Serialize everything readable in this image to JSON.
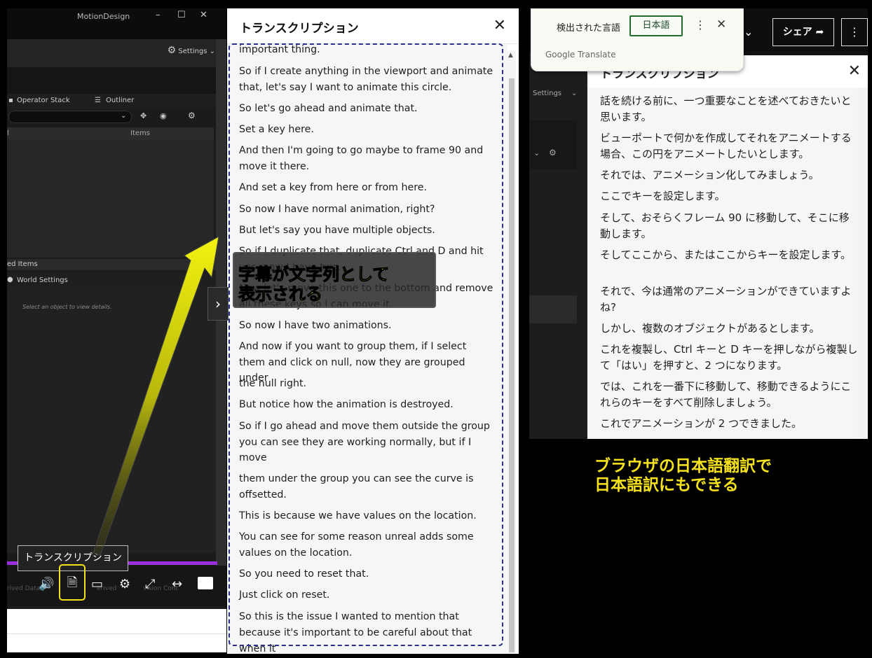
{
  "video": {
    "window_title": "MotionDesign",
    "window_controls": [
      "–",
      "☐",
      "✕"
    ],
    "settings_label": "Settings",
    "operator_stack": "Operator Stack",
    "outliner": "Outliner",
    "column_left": "l",
    "column_items": "Items",
    "section_items": "ed Items",
    "world_settings": "World Settings",
    "details_hint": "Select an object to view details.",
    "bottom_faint_left": "rived Data",
    "bottom_faint_mid": "erived",
    "bottom_faint_right": "vision Cont",
    "tooltip": "トランスクリプション"
  },
  "transcript": {
    "title": "トランスクリプション",
    "segments": [
      "important thing.",
      "So if I create anything in the viewport and animate that, let's say I want to animate this circle.",
      "So let's go ahead and animate that.",
      "Set a key here.",
      "And then I'm going to go maybe to frame 90 and move it there.",
      "And set a key from here or from here.",
      "So now I have normal animation, right?",
      "But let's say you have multiple objects.",
      "So if I duplicate that, duplicate Ctrl and D and hit yes, now I have two.",
      "Now let's move this one to the bottom and remove all these keys so I can move it.",
      "So now I have two animations.",
      "And now if you want to group them, if I select them and click on null, now they are grouped under",
      "the null right.",
      "But notice how the animation is destroyed.",
      "So if I go ahead and move them outside the group you can see they are working normally, but if I move",
      "them under the group you can see the curve is offsetted.",
      "This is because we have values on the location.",
      "You can see for some reason unreal adds some values on the location.",
      "So you need to reset that.",
      "Just click on reset.",
      "So this is the issue I wanted to mention that because it's important to be careful about that",
      "when it"
    ]
  },
  "callout": {
    "line1": "字幕が文字列として",
    "line2": "表示される"
  },
  "translate_popup": {
    "detected_label": "検出された言語",
    "target_language": "日本語",
    "brand": "Google Translate"
  },
  "right": {
    "share_label": "シェア",
    "settings_label": "Settings",
    "panel_title": "トランスクリプション",
    "segments": [
      "話を続ける前に、一つ重要なことを述べておきたいと思います。",
      "ビューポートで何かを作成してそれをアニメートする場合、この円をアニメートしたいとします。",
      "それでは、アニメーション化してみましょう。",
      "ここでキーを設定します。",
      "そして、おそらくフレーム 90 に移動して、そこに移動します。",
      "そしてここから、またはここからキーを設定します。",
      "それで、今は通常のアニメーションができていますよね?",
      "しかし、複数のオブジェクトがあるとします。",
      "これを複製し、Ctrl キーと D キーを押しながら複製して「はい」を押すと、2 つになります。",
      "では、これを一番下に移動して、移動できるようにこれらのキーをすべて削除しましょう。",
      "これでアニメーションが 2 つできました。"
    ]
  },
  "caption": {
    "line1": "ブラウザの日本語翻訳で",
    "line2": "日本語訳にもできる"
  },
  "colors": {
    "highlight_yellow": "#f5e21c",
    "progress_purple": "#9b2fe0",
    "dash_border": "#2c2f8a"
  }
}
